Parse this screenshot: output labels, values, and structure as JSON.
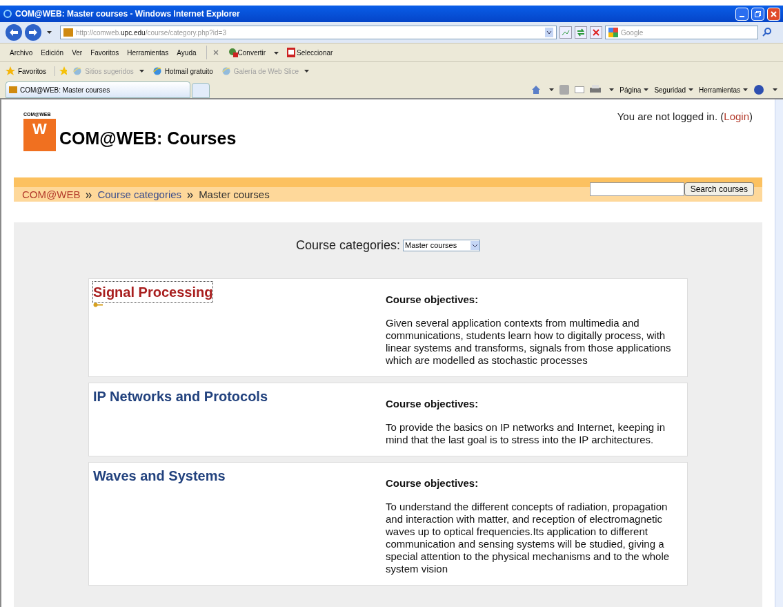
{
  "window": {
    "title": "COM@WEB: Master courses - Windows Internet Explorer"
  },
  "address_bar": {
    "url_parts": [
      {
        "text": "http://comweb.",
        "kind": "dim"
      },
      {
        "text": "upc.edu",
        "kind": "strong"
      },
      {
        "text": "/course/category.php?id=3",
        "kind": "dim"
      }
    ]
  },
  "search_box": {
    "placeholder": "Google"
  },
  "menu_bar": [
    "Archivo",
    "Edición",
    "Ver",
    "Favoritos",
    "Herramientas",
    "Ayuda"
  ],
  "addon_toolbar": {
    "convert": "Convertir",
    "select": "Seleccionar"
  },
  "favorites_bar": {
    "label": "Favoritos",
    "links": [
      {
        "text": "Sitios sugeridos",
        "disabled": true,
        "dropdown": true
      },
      {
        "text": "Hotmail gratuito",
        "disabled": false,
        "dropdown": false
      },
      {
        "text": "Galería de Web Slice",
        "disabled": true,
        "dropdown": true
      }
    ]
  },
  "tabs": [
    {
      "label": "COM@WEB: Master courses",
      "selected": true
    }
  ],
  "command_bar": [
    "Página",
    "Seguridad",
    "Herramientas"
  ],
  "page": {
    "logo": {
      "caption": "COM@WEB",
      "letter": "W"
    },
    "heading": "COM@WEB: Courses",
    "login": {
      "text": "You are not logged in. (",
      "link": "Login",
      "suffix": ")"
    },
    "breadcrumb": [
      {
        "text": "COM@WEB",
        "kind": "home"
      },
      {
        "text": "Course categories",
        "kind": "link"
      },
      {
        "text": "Master courses",
        "kind": "current"
      }
    ],
    "course_search": {
      "button": "Search courses"
    },
    "category_selector": {
      "label": "Course categories:",
      "value": "Master courses"
    },
    "courses": [
      {
        "name": "Signal Processing",
        "focused": true,
        "enrolment_key": true,
        "objectives_label": "Course objectives:",
        "objectives": "Given several application contexts from multimedia and communications, students learn how to digitally process, with linear systems and transforms, signals from those applications which are modelled as stochastic processes"
      },
      {
        "name": "IP Networks and Protocols",
        "focused": false,
        "enrolment_key": false,
        "objectives_label": "Course objectives:",
        "objectives": "To provide the basics on IP networks and Internet, keeping in mind that the last goal is to stress into the IP architectures."
      },
      {
        "name": "Waves and Systems",
        "focused": false,
        "enrolment_key": false,
        "objectives_label": "Course objectives:",
        "objectives": "To understand the different concepts of radiation, propagation and interaction with matter, and reception of electromagnetic waves up to optical frequencies.Its application to different communication and sensing systems will be studied, giving a special attention to the physical mechanisms and to the whole system vision"
      }
    ]
  }
}
